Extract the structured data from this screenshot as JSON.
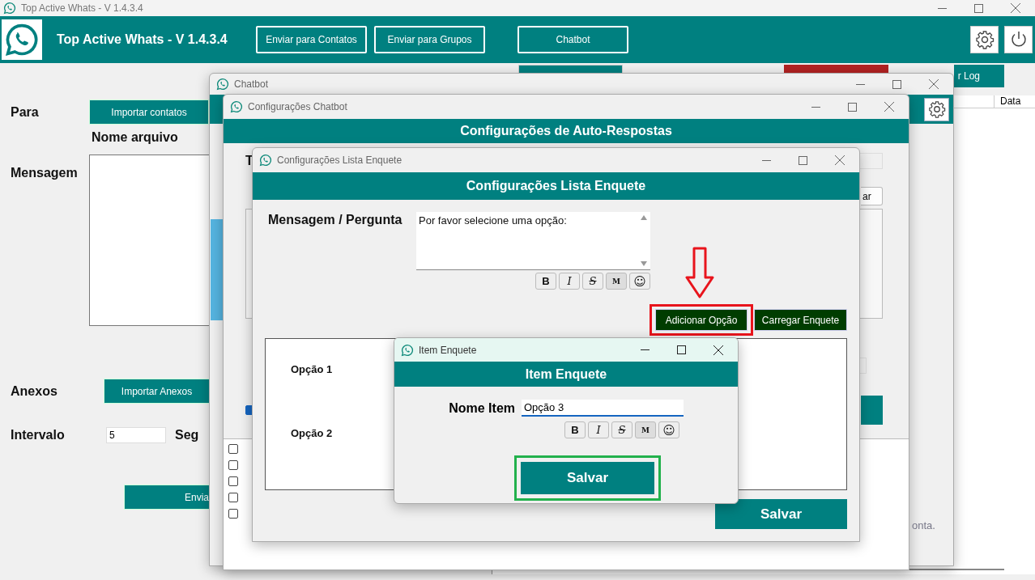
{
  "window": {
    "title": "Top Active Whats - V 1.4.3.4"
  },
  "header": {
    "title": "Top Active Whats - V 1.4.3.4",
    "buttons": [
      "Enviar para Contatos",
      "Enviar para Grupos",
      "Chatbot"
    ]
  },
  "form": {
    "para_label": "Para",
    "import_contacts_button": "Importar contatos",
    "file_name_label": "Nome arquivo",
    "message_label": "Mensagem",
    "attachments_label": "Anexos",
    "import_attachments_button": "Importar Anexos",
    "interval_label": "Intervalo",
    "interval_value": "5",
    "interval_unit": "Seg",
    "send_button": "Envia"
  },
  "right_panel": {
    "log_button": "r Log",
    "columns": [
      "Data"
    ]
  },
  "chatbot_window": {
    "title": "Chatbot"
  },
  "chatbot_config_window": {
    "title": "Configurações Chatbot",
    "heading": "Configurações de Auto-Respostas",
    "label_1": "T",
    "side_button": "ar",
    "option_checked": true,
    "list_rows": [
      {
        "checked": false
      },
      {
        "checked": false
      },
      {
        "checked": false
      },
      {
        "checked": false
      },
      {
        "checked": false
      }
    ],
    "note": "onta."
  },
  "poll_window": {
    "title": "Configurações Lista Enquete",
    "heading": "Configurações Lista Enquete",
    "message_label": "Mensagem / Pergunta",
    "message_value": "Por favor selecione uma opção:",
    "format_buttons": [
      {
        "label": "B",
        "kind": "bold"
      },
      {
        "label": "I",
        "kind": "italic"
      },
      {
        "label": "S",
        "kind": "strike"
      },
      {
        "label": "M",
        "kind": "mono"
      },
      {
        "label": "☺",
        "kind": "emoji"
      }
    ],
    "add_option_button": "Adicionar Opção",
    "load_poll_button": "Carregar Enquete",
    "options": [
      "Opção 1",
      "Opção 2"
    ],
    "save_button": "Salvar"
  },
  "item_window": {
    "title": "Item Enquete",
    "heading": "Item Enquete",
    "name_label": "Nome Item",
    "name_value": "Opção 3",
    "format_buttons": [
      {
        "label": "B",
        "kind": "bold"
      },
      {
        "label": "I",
        "kind": "italic"
      },
      {
        "label": "S",
        "kind": "strike"
      },
      {
        "label": "M",
        "kind": "mono"
      },
      {
        "label": "☺",
        "kind": "emoji"
      }
    ],
    "save_button": "Salvar"
  }
}
